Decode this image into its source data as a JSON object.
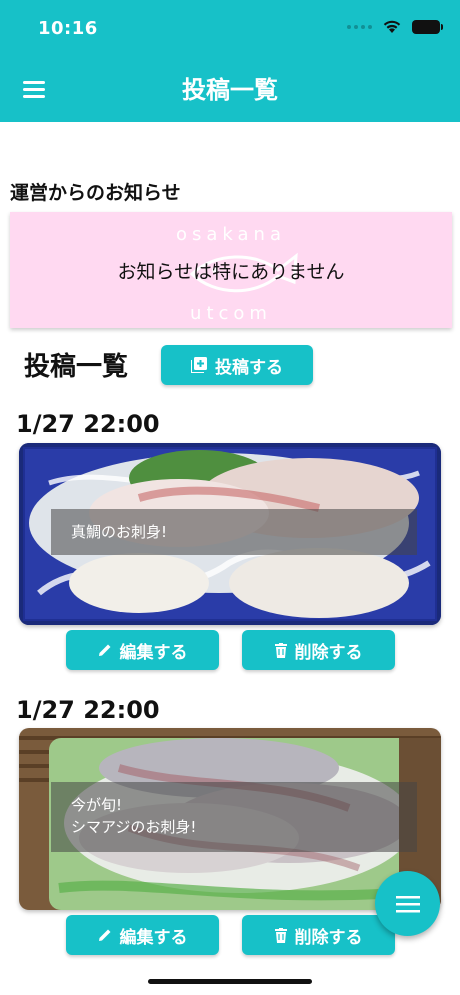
{
  "status_bar": {
    "time": "10:16"
  },
  "app_bar": {
    "title": "投稿一覧",
    "menu_icon": "hamburger-icon"
  },
  "notice": {
    "heading": "運営からのお知らせ",
    "text": "お知らせは特にありません",
    "watermark_top": "osakana",
    "watermark_bottom": "utcom"
  },
  "posts_section": {
    "heading": "投稿一覧",
    "create_button": "投稿する",
    "create_icon": "add-box-icon"
  },
  "posts": [
    {
      "date": "1/27 22:00",
      "caption": "真鯛のお刺身!",
      "edit_label": "編集する",
      "delete_label": "削除する"
    },
    {
      "date": "1/27 22:00",
      "caption_line1": "今が旬!",
      "caption_line2": "シマアジのお刺身!",
      "edit_label": "編集する",
      "delete_label": "削除する"
    }
  ],
  "fab": {
    "icon": "menu-icon"
  },
  "colors": {
    "accent": "#17c1c8",
    "notice_bg": "#ffd9f1"
  }
}
